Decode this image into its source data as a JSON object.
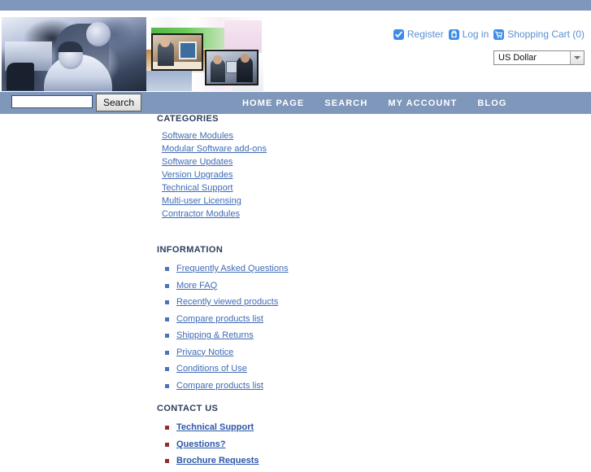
{
  "theme": {
    "bar_color": "#7e97ba",
    "link_color": "#3f6bb5",
    "heading_color": "#2c3e5c",
    "util_link_color": "#5b8fd0",
    "util_icon_color": "#3d8ce8",
    "info_bullet_color": "#4b73b8",
    "contact_bullet_color": "#8e2f2f"
  },
  "header": {
    "banner_alt": "business people working at computers banner",
    "utility_links": [
      {
        "label": "Register",
        "icon": "check-icon"
      },
      {
        "label": "Log in",
        "icon": "login-key-icon"
      },
      {
        "label": "Shopping Cart (0)",
        "icon": "shopping-cart-icon"
      }
    ],
    "currency": {
      "selected": "US Dollar",
      "options": [
        "US Dollar"
      ]
    }
  },
  "navbar": {
    "search": {
      "value": "",
      "placeholder": "",
      "button_label": "Search"
    },
    "links": [
      {
        "label": "Home page"
      },
      {
        "label": "Search"
      },
      {
        "label": "My account"
      },
      {
        "label": "Blog"
      }
    ]
  },
  "sidebar": {
    "categories": {
      "title": "Categories",
      "items": [
        {
          "label": "Software Modules"
        },
        {
          "label": "Modular Software add-ons"
        },
        {
          "label": "Software Updates"
        },
        {
          "label": "Version Upgrades"
        },
        {
          "label": "Technical Support"
        },
        {
          "label": "Multi-user Licensing"
        },
        {
          "label": "Contractor Modules"
        }
      ]
    },
    "information": {
      "title": "Information",
      "items": [
        {
          "label": "Frequently Asked Questions"
        },
        {
          "label": "More FAQ"
        },
        {
          "label": "Recently viewed products"
        },
        {
          "label": "Compare products list"
        },
        {
          "label": "Shipping & Returns"
        },
        {
          "label": "Privacy Notice"
        },
        {
          "label": "Conditions of Use"
        },
        {
          "label": "Compare products list"
        }
      ]
    },
    "contact": {
      "title": "Contact us",
      "items": [
        {
          "label": "Technical Support"
        },
        {
          "label": "Questions?"
        },
        {
          "label": "Brochure Requests"
        }
      ]
    }
  }
}
